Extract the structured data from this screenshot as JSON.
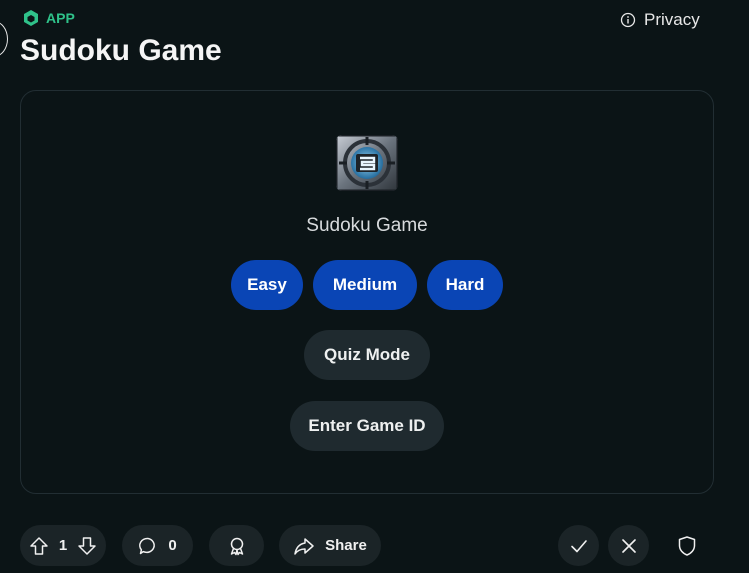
{
  "header": {
    "app_badge": "APP",
    "title": "Sudoku Game",
    "privacy_label": "Privacy"
  },
  "card": {
    "game_name": "Sudoku Game",
    "difficulty_buttons": [
      "Easy",
      "Medium",
      "Hard"
    ],
    "quiz_mode_label": "Quiz Mode",
    "enter_game_id_label": "Enter Game ID"
  },
  "footer": {
    "vote_count": "1",
    "comment_count": "0",
    "share_label": "Share"
  },
  "icons": {
    "app_badge": "cube-icon",
    "privacy": "info-icon",
    "upvote": "arrow-up-icon",
    "downvote": "arrow-down-icon",
    "comments": "comment-bubble-icon",
    "award": "award-icon",
    "share": "share-arrow-icon",
    "approve": "checkmark-icon",
    "remove": "close-icon",
    "mod": "shield-icon"
  },
  "colors": {
    "background": "#0b1416",
    "accent_green": "#2fc28a",
    "primary_button": "#0a45b5",
    "secondary_button": "#1f2a2f"
  }
}
